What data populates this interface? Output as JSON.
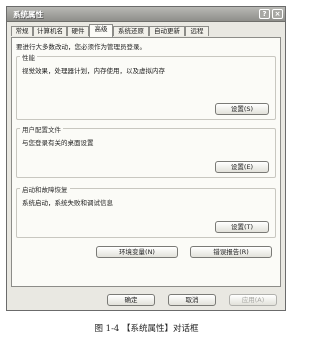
{
  "window": {
    "title": "系统属性",
    "help_label": "?",
    "close_label": "×"
  },
  "tabs": [
    "常规",
    "计算机名",
    "硬件",
    "高级",
    "系统还原",
    "自动更新",
    "远程"
  ],
  "intro_text": "要进行大多数改动，您必须作为管理员登录。",
  "groups": [
    {
      "title": "性能",
      "description": "视觉效果，处理器计划，内存使用，以及虚拟内存",
      "button": "设置(S)"
    },
    {
      "title": "用户配置文件",
      "description": "与您登录有关的桌面设置",
      "button": "设置(E)"
    },
    {
      "title": "启动和故障恢复",
      "description": "系统启动，系统失败和调试信息",
      "button": "设置(T)"
    }
  ],
  "extra_buttons": {
    "env": "环境变量(N)",
    "error": "错误报告(R)"
  },
  "footer": {
    "ok": "确定",
    "cancel": "取消",
    "apply": "应用(A)"
  },
  "caption": "图 1-4 【系统属性】对话框"
}
